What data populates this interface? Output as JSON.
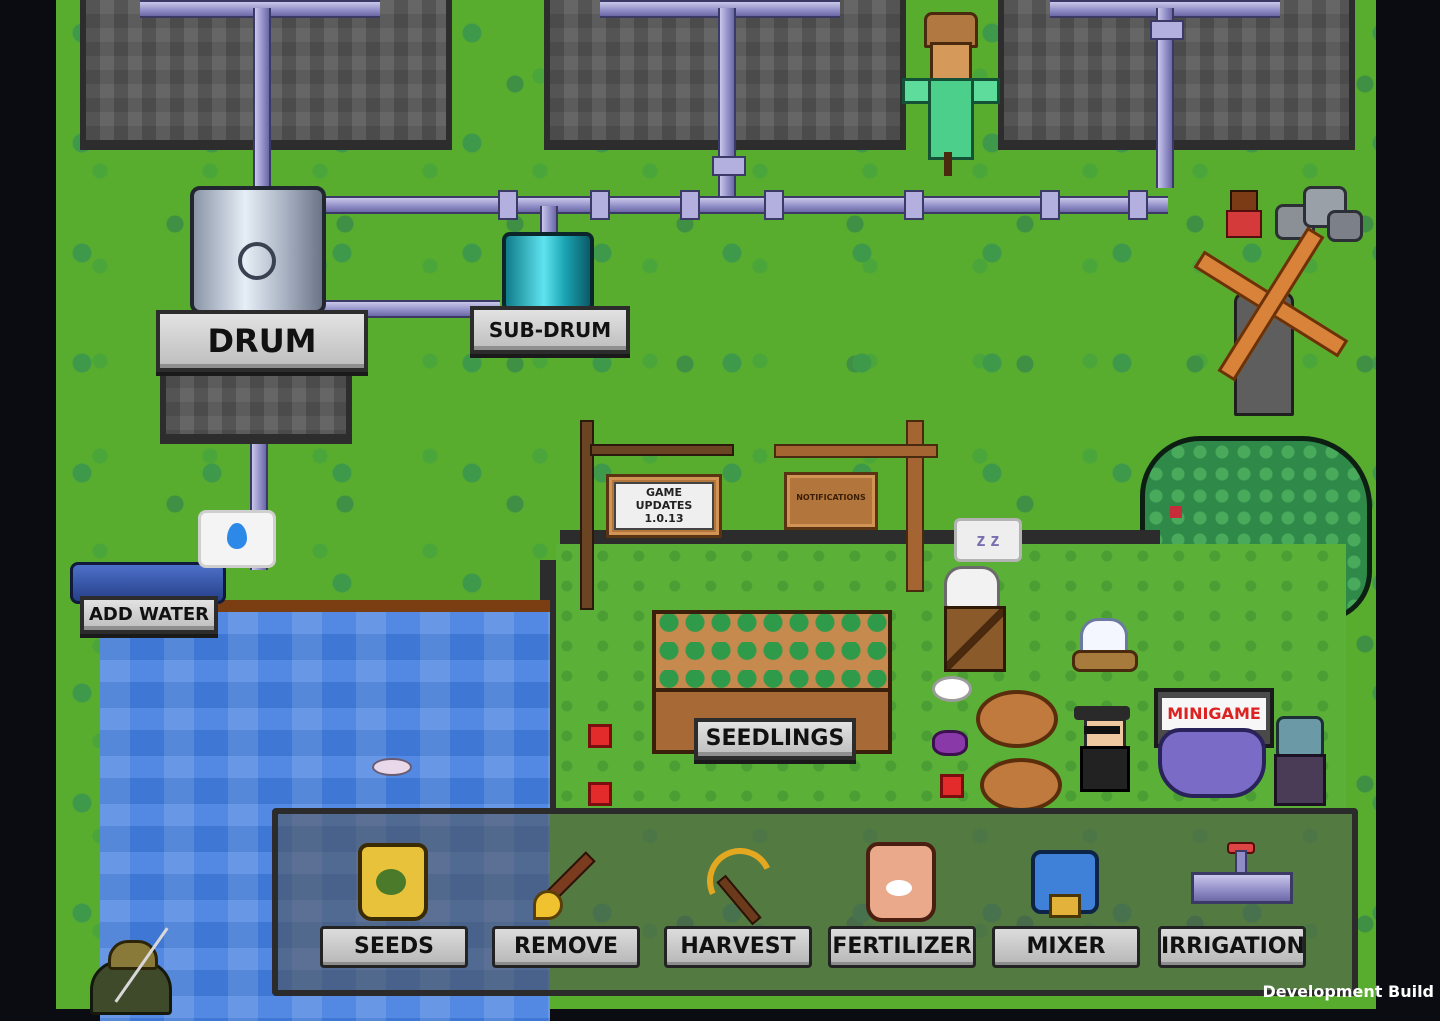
{
  "farm": {
    "drum_label": "DRUM",
    "subdrum_label": "SUB-DRUM",
    "add_water_label": "ADD WATER",
    "game_updates": {
      "line1": "GAME",
      "line2": "UPDATES",
      "version": "1.0.13"
    },
    "notifications_label": "NOTIFICATIONS",
    "seedlings_label": "SEEDLINGS",
    "minigame_label": "MINIGAME",
    "sleep_bubble": "z z"
  },
  "toolbar": {
    "tools": [
      {
        "label": "SEEDS",
        "icon": "seed-bag-icon"
      },
      {
        "label": "REMOVE",
        "icon": "shovel-icon"
      },
      {
        "label": "HARVEST",
        "icon": "scythe-icon"
      },
      {
        "label": "FERTILIZER",
        "icon": "fertilizer-bag-icon"
      },
      {
        "label": "MIXER",
        "icon": "mixer-icon"
      },
      {
        "label": "IRRIGATION",
        "icon": "valve-pipe-icon"
      }
    ]
  },
  "footer": {
    "build_label": "Development Build"
  },
  "colors": {
    "grass": "#58ad2f",
    "water": "#3f78d4",
    "pipe": "#8f8cc6",
    "plate": "#bdbdbd"
  }
}
